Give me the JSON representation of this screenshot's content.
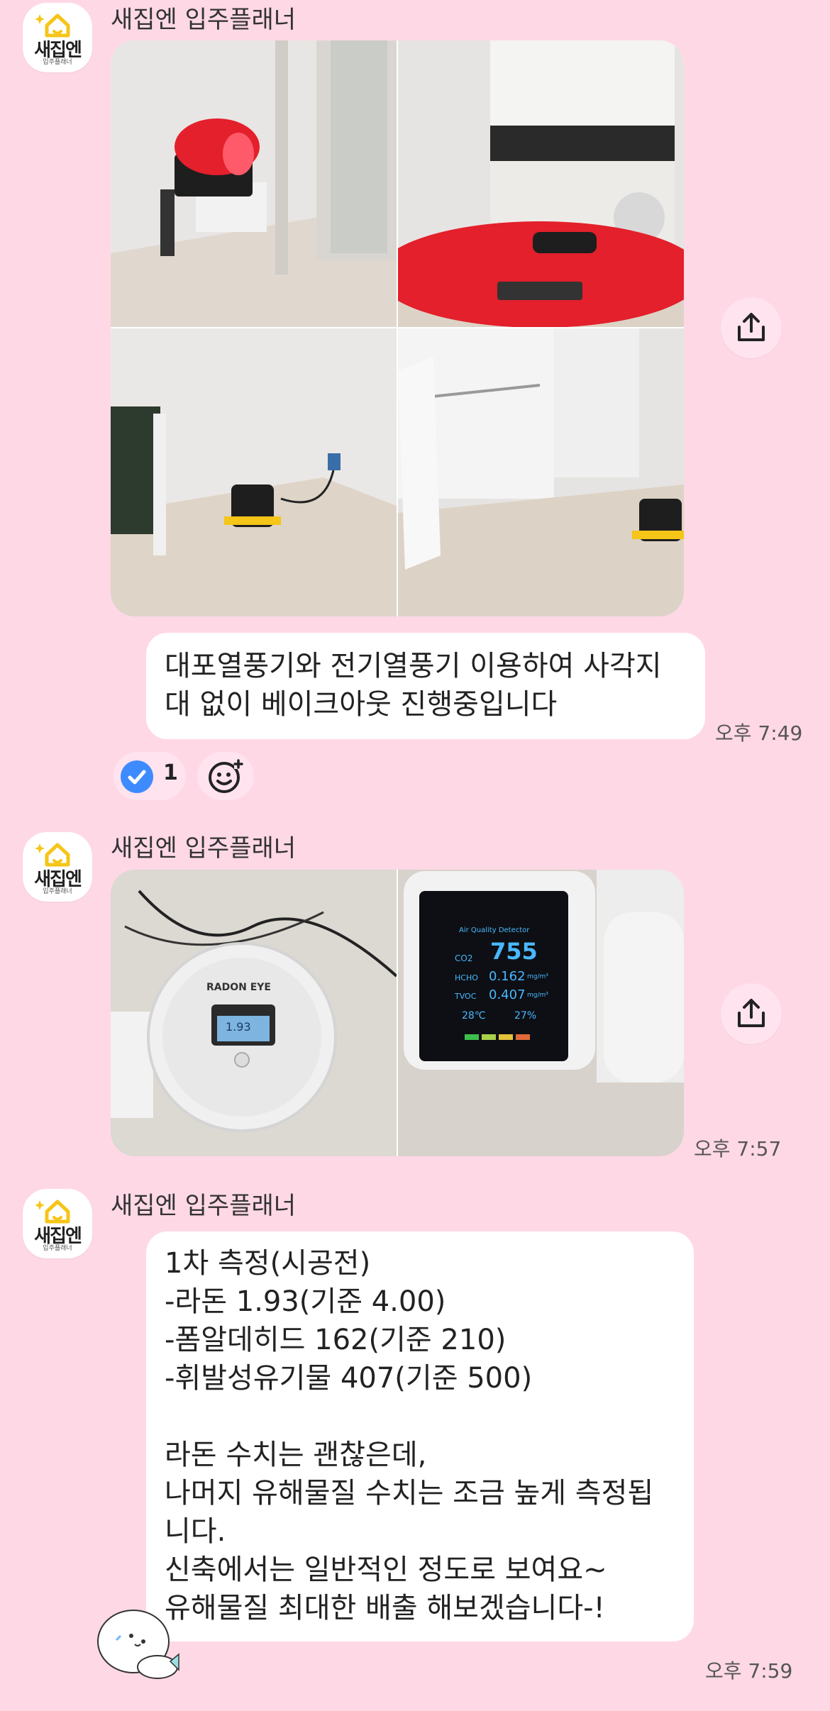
{
  "messages": [
    {
      "sender": "새집엔 입주플래너",
      "avatar_text": "새집엔",
      "avatar_sub": "입주플래너",
      "type": "photos",
      "photos": [
        "heater-room",
        "heater-kitchen",
        "electric-heater-corner",
        "electric-heater-closet"
      ]
    },
    {
      "type": "text",
      "lines": [
        "대포열풍기와 전기열풍기 이용하여 사각지",
        "대 없이 베이크아웃 진행중입니다"
      ],
      "time": "오후 7:49",
      "reaction_count": "1"
    },
    {
      "sender": "새집엔 입주플래너",
      "avatar_text": "새집엔",
      "avatar_sub": "입주플래너",
      "type": "photos",
      "photos": [
        "radon-eye",
        "air-quality-detector"
      ],
      "time": "오후 7:57",
      "radon_label": "RADON EYE",
      "radon_value": "1.93",
      "detector": {
        "title": "Air Quality Detector",
        "co2_label": "CO2",
        "co2_value": "755",
        "hcho_label": "HCHO",
        "hcho_value": "0.162",
        "tvoc_label": "TVOC",
        "tvoc_value": "0.407",
        "unit": "mg/m³",
        "temp": "28℃",
        "humidity": "27%"
      }
    },
    {
      "sender": "새집엔 입주플래너",
      "avatar_text": "새집엔",
      "avatar_sub": "입주플래너",
      "type": "text",
      "lines": [
        "1차 측정(시공전)",
        "-라돈 1.93(기준 4.00)",
        "-폼알데히드 162(기준 210)",
        "-휘발성유기물 407(기준 500)",
        "",
        "라돈 수치는 괜찮은데,",
        "나머지 유해물질 수치는 조금 높게 측정됩",
        "니다.",
        "신축에서는 일반적인 정도로 보여요~",
        "유해물질 최대한 배출 해보겠습니다-!"
      ],
      "time": "오후 7:59"
    }
  ],
  "colors": {
    "background": "#FFD8E6",
    "bubble": "#FFFFFF",
    "share_button": "#FFE3EE",
    "check_badge": "#3D8BFF",
    "logo_yellow": "#F5C518",
    "heater_red": "#E3202B"
  },
  "icons": [
    "share-icon",
    "check-icon",
    "add-emoji-icon",
    "house-logo-icon",
    "sticker-seal-icon"
  ]
}
